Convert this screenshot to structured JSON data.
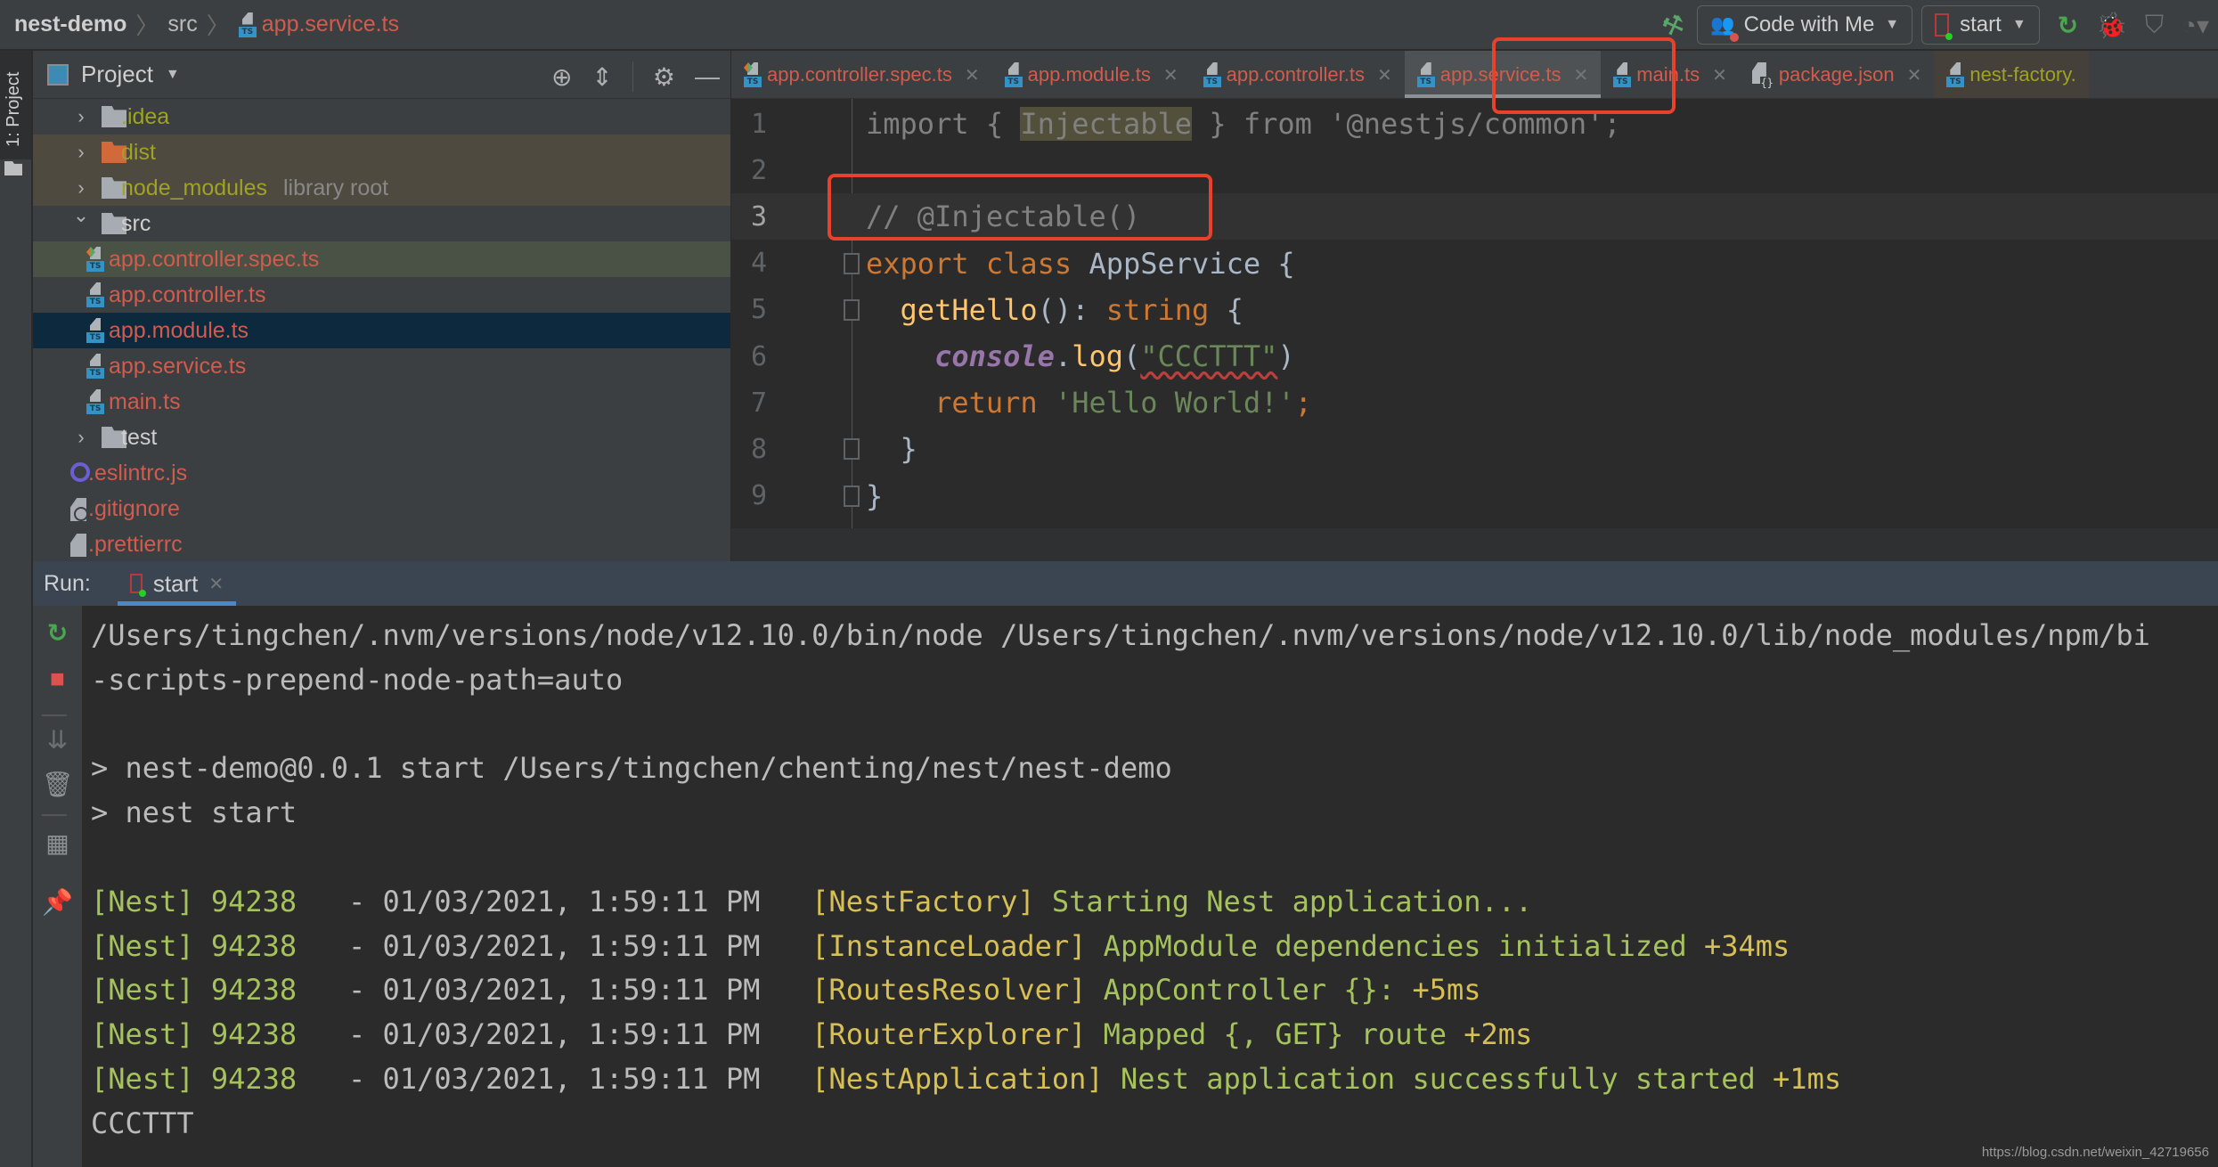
{
  "breadcrumb": {
    "project": "nest-demo",
    "folder": "src",
    "file": "app.service.ts",
    "file_icon_label": "TS"
  },
  "toolbar": {
    "build_icon": "hammer-icon",
    "code_with_me_label": "Code with Me",
    "run_config_label": "start",
    "icons": [
      "rerun-icon",
      "debug-icon",
      "coverage-icon",
      "profile-icon"
    ]
  },
  "left_strip": {
    "project_tab_label": "1: Project"
  },
  "project_panel": {
    "title": "Project",
    "tools": [
      "locate-icon",
      "collapse-all-icon",
      "gear-icon",
      "minimize-icon"
    ],
    "tree": [
      {
        "name": ".idea",
        "type": "folder",
        "expanded": false,
        "indent": 0
      },
      {
        "name": "dist",
        "type": "folder-excluded",
        "expanded": false,
        "indent": 0
      },
      {
        "name": "node_modules",
        "suffix": "library root",
        "type": "folder",
        "expanded": false,
        "indent": 0
      },
      {
        "name": "src",
        "type": "folder",
        "expanded": true,
        "indent": 0
      },
      {
        "name": "app.controller.spec.ts",
        "type": "ts-spec",
        "indent": 1
      },
      {
        "name": "app.controller.ts",
        "type": "ts",
        "indent": 1
      },
      {
        "name": "app.module.ts",
        "type": "ts",
        "indent": 1,
        "selected": true
      },
      {
        "name": "app.service.ts",
        "type": "ts",
        "indent": 1
      },
      {
        "name": "main.ts",
        "type": "ts",
        "indent": 1
      },
      {
        "name": "test",
        "type": "folder",
        "expanded": false,
        "indent": 0
      },
      {
        "name": ".eslintrc.js",
        "type": "eslint",
        "indent": 0
      },
      {
        "name": ".gitignore",
        "type": "gitignore",
        "indent": 0
      },
      {
        "name": ".prettierrc",
        "type": "text",
        "indent": 0
      }
    ]
  },
  "editor_tabs": [
    {
      "label": "app.controller.spec.ts",
      "icon": "ts-spec"
    },
    {
      "label": "app.module.ts",
      "icon": "ts"
    },
    {
      "label": "app.controller.ts",
      "icon": "ts"
    },
    {
      "label": "app.service.ts",
      "icon": "ts",
      "active": true
    },
    {
      "label": "main.ts",
      "icon": "ts"
    },
    {
      "label": "package.json",
      "icon": "json"
    },
    {
      "label": "nest-factory.",
      "icon": "ts",
      "other": true
    }
  ],
  "editor": {
    "current_line": 3,
    "lines": [
      {
        "n": "1",
        "tokens": [
          [
            "import { ",
            "k-gray"
          ],
          [
            "Injectable",
            "k-hl"
          ],
          [
            " } from '@nestjs/common';",
            "k-gray"
          ]
        ]
      },
      {
        "n": "2",
        "tokens": []
      },
      {
        "n": "3",
        "tokens": [
          [
            "// @Injectable()",
            "k-cmt"
          ]
        ]
      },
      {
        "n": "4",
        "fold": true,
        "tokens": [
          [
            "export class ",
            "k-kw"
          ],
          [
            "AppService {",
            "k-plain"
          ]
        ]
      },
      {
        "n": "5",
        "fold": true,
        "tokens": [
          [
            "  ",
            "k-plain"
          ],
          [
            "getHello",
            "k-fn"
          ],
          [
            "(): ",
            "k-plain"
          ],
          [
            "string",
            "k-kw"
          ],
          [
            " {",
            "k-plain"
          ]
        ]
      },
      {
        "n": "6",
        "tokens": [
          [
            "    ",
            "k-plain"
          ],
          [
            "console",
            "k-glob"
          ],
          [
            ".",
            "k-plain"
          ],
          [
            "log",
            "k-fn"
          ],
          [
            "(",
            "k-plain"
          ],
          [
            "\"CCCTTT\"",
            "k-str squiggle"
          ],
          [
            ")",
            "k-plain"
          ]
        ]
      },
      {
        "n": "7",
        "tokens": [
          [
            "    ",
            "k-plain"
          ],
          [
            "return ",
            "k-kw"
          ],
          [
            "'Hello World!'",
            "k-str"
          ],
          [
            ";",
            "k-kw"
          ]
        ]
      },
      {
        "n": "8",
        "fold": true,
        "tokens": [
          [
            "  }",
            "k-plain"
          ]
        ]
      },
      {
        "n": "9",
        "fold": true,
        "tokens": [
          [
            "}",
            "k-plain"
          ]
        ]
      }
    ]
  },
  "run_panel": {
    "label": "Run:",
    "tab_label": "start",
    "tools": [
      "rerun-icon",
      "stop-icon",
      "scroll-to-end-icon",
      "clear-icon",
      "layout-icon",
      "pin-icon"
    ],
    "console_lines": [
      {
        "segments": [
          [
            "/Users/tingchen/.nvm/versions/node/v12.10.0/bin/node /Users/tingchen/.nvm/versions/node/v12.10.0/lib/node_modules/npm/bi",
            "n-gray"
          ]
        ]
      },
      {
        "segments": [
          [
            "-scripts-prepend-node-path=auto",
            "n-gray"
          ]
        ]
      },
      {
        "segments": []
      },
      {
        "segments": [
          [
            "> nest-demo@0.0.1 start /Users/tingchen/chenting/nest/nest-demo",
            "n-gray"
          ]
        ]
      },
      {
        "segments": [
          [
            "> nest start",
            "n-gray"
          ]
        ]
      },
      {
        "segments": []
      },
      {
        "segments": [
          [
            "[Nest] 94238   ",
            "n-green"
          ],
          [
            "- 01/03/2021, 1:59:11 PM   ",
            "n-gray"
          ],
          [
            "[NestFactory] ",
            "n-yellow"
          ],
          [
            "Starting Nest application...",
            "n-green"
          ]
        ]
      },
      {
        "segments": [
          [
            "[Nest] 94238   ",
            "n-green"
          ],
          [
            "- 01/03/2021, 1:59:11 PM   ",
            "n-gray"
          ],
          [
            "[InstanceLoader] ",
            "n-yellow"
          ],
          [
            "AppModule dependencies initialized ",
            "n-green"
          ],
          [
            "+34ms",
            "n-yellow"
          ]
        ]
      },
      {
        "segments": [
          [
            "[Nest] 94238   ",
            "n-green"
          ],
          [
            "- 01/03/2021, 1:59:11 PM   ",
            "n-gray"
          ],
          [
            "[RoutesResolver] ",
            "n-yellow"
          ],
          [
            "AppController {}: ",
            "n-green"
          ],
          [
            "+5ms",
            "n-yellow"
          ]
        ]
      },
      {
        "segments": [
          [
            "[Nest] 94238   ",
            "n-green"
          ],
          [
            "- 01/03/2021, 1:59:11 PM   ",
            "n-gray"
          ],
          [
            "[RouterExplorer] ",
            "n-yellow"
          ],
          [
            "Mapped {, GET} route ",
            "n-green"
          ],
          [
            "+2ms",
            "n-yellow"
          ]
        ]
      },
      {
        "segments": [
          [
            "[Nest] 94238   ",
            "n-green"
          ],
          [
            "- 01/03/2021, 1:59:11 PM   ",
            "n-gray"
          ],
          [
            "[NestApplication] ",
            "n-yellow"
          ],
          [
            "Nest application successfully started ",
            "n-green"
          ],
          [
            "+1ms",
            "n-yellow"
          ]
        ]
      },
      {
        "segments": [
          [
            "CCCTTT",
            "n-gray"
          ]
        ]
      }
    ]
  },
  "watermark": "https://blog.csdn.net/weixin_42719656",
  "colors": {
    "annotation_red": "#e8412c",
    "file_modified": "#d25b4c",
    "ignored_yellow": "#9fa321",
    "selection": "#0d293e"
  }
}
